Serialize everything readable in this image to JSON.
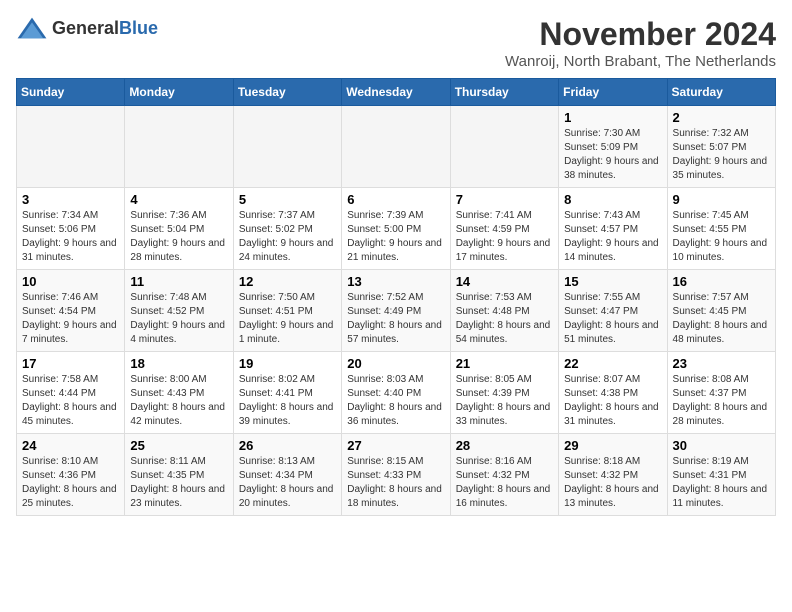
{
  "header": {
    "logo_general": "General",
    "logo_blue": "Blue",
    "month": "November 2024",
    "location": "Wanroij, North Brabant, The Netherlands"
  },
  "weekdays": [
    "Sunday",
    "Monday",
    "Tuesday",
    "Wednesday",
    "Thursday",
    "Friday",
    "Saturday"
  ],
  "weeks": [
    [
      {
        "day": "",
        "info": ""
      },
      {
        "day": "",
        "info": ""
      },
      {
        "day": "",
        "info": ""
      },
      {
        "day": "",
        "info": ""
      },
      {
        "day": "",
        "info": ""
      },
      {
        "day": "1",
        "info": "Sunrise: 7:30 AM\nSunset: 5:09 PM\nDaylight: 9 hours and 38 minutes."
      },
      {
        "day": "2",
        "info": "Sunrise: 7:32 AM\nSunset: 5:07 PM\nDaylight: 9 hours and 35 minutes."
      }
    ],
    [
      {
        "day": "3",
        "info": "Sunrise: 7:34 AM\nSunset: 5:06 PM\nDaylight: 9 hours and 31 minutes."
      },
      {
        "day": "4",
        "info": "Sunrise: 7:36 AM\nSunset: 5:04 PM\nDaylight: 9 hours and 28 minutes."
      },
      {
        "day": "5",
        "info": "Sunrise: 7:37 AM\nSunset: 5:02 PM\nDaylight: 9 hours and 24 minutes."
      },
      {
        "day": "6",
        "info": "Sunrise: 7:39 AM\nSunset: 5:00 PM\nDaylight: 9 hours and 21 minutes."
      },
      {
        "day": "7",
        "info": "Sunrise: 7:41 AM\nSunset: 4:59 PM\nDaylight: 9 hours and 17 minutes."
      },
      {
        "day": "8",
        "info": "Sunrise: 7:43 AM\nSunset: 4:57 PM\nDaylight: 9 hours and 14 minutes."
      },
      {
        "day": "9",
        "info": "Sunrise: 7:45 AM\nSunset: 4:55 PM\nDaylight: 9 hours and 10 minutes."
      }
    ],
    [
      {
        "day": "10",
        "info": "Sunrise: 7:46 AM\nSunset: 4:54 PM\nDaylight: 9 hours and 7 minutes."
      },
      {
        "day": "11",
        "info": "Sunrise: 7:48 AM\nSunset: 4:52 PM\nDaylight: 9 hours and 4 minutes."
      },
      {
        "day": "12",
        "info": "Sunrise: 7:50 AM\nSunset: 4:51 PM\nDaylight: 9 hours and 1 minute."
      },
      {
        "day": "13",
        "info": "Sunrise: 7:52 AM\nSunset: 4:49 PM\nDaylight: 8 hours and 57 minutes."
      },
      {
        "day": "14",
        "info": "Sunrise: 7:53 AM\nSunset: 4:48 PM\nDaylight: 8 hours and 54 minutes."
      },
      {
        "day": "15",
        "info": "Sunrise: 7:55 AM\nSunset: 4:47 PM\nDaylight: 8 hours and 51 minutes."
      },
      {
        "day": "16",
        "info": "Sunrise: 7:57 AM\nSunset: 4:45 PM\nDaylight: 8 hours and 48 minutes."
      }
    ],
    [
      {
        "day": "17",
        "info": "Sunrise: 7:58 AM\nSunset: 4:44 PM\nDaylight: 8 hours and 45 minutes."
      },
      {
        "day": "18",
        "info": "Sunrise: 8:00 AM\nSunset: 4:43 PM\nDaylight: 8 hours and 42 minutes."
      },
      {
        "day": "19",
        "info": "Sunrise: 8:02 AM\nSunset: 4:41 PM\nDaylight: 8 hours and 39 minutes."
      },
      {
        "day": "20",
        "info": "Sunrise: 8:03 AM\nSunset: 4:40 PM\nDaylight: 8 hours and 36 minutes."
      },
      {
        "day": "21",
        "info": "Sunrise: 8:05 AM\nSunset: 4:39 PM\nDaylight: 8 hours and 33 minutes."
      },
      {
        "day": "22",
        "info": "Sunrise: 8:07 AM\nSunset: 4:38 PM\nDaylight: 8 hours and 31 minutes."
      },
      {
        "day": "23",
        "info": "Sunrise: 8:08 AM\nSunset: 4:37 PM\nDaylight: 8 hours and 28 minutes."
      }
    ],
    [
      {
        "day": "24",
        "info": "Sunrise: 8:10 AM\nSunset: 4:36 PM\nDaylight: 8 hours and 25 minutes."
      },
      {
        "day": "25",
        "info": "Sunrise: 8:11 AM\nSunset: 4:35 PM\nDaylight: 8 hours and 23 minutes."
      },
      {
        "day": "26",
        "info": "Sunrise: 8:13 AM\nSunset: 4:34 PM\nDaylight: 8 hours and 20 minutes."
      },
      {
        "day": "27",
        "info": "Sunrise: 8:15 AM\nSunset: 4:33 PM\nDaylight: 8 hours and 18 minutes."
      },
      {
        "day": "28",
        "info": "Sunrise: 8:16 AM\nSunset: 4:32 PM\nDaylight: 8 hours and 16 minutes."
      },
      {
        "day": "29",
        "info": "Sunrise: 8:18 AM\nSunset: 4:32 PM\nDaylight: 8 hours and 13 minutes."
      },
      {
        "day": "30",
        "info": "Sunrise: 8:19 AM\nSunset: 4:31 PM\nDaylight: 8 hours and 11 minutes."
      }
    ]
  ]
}
